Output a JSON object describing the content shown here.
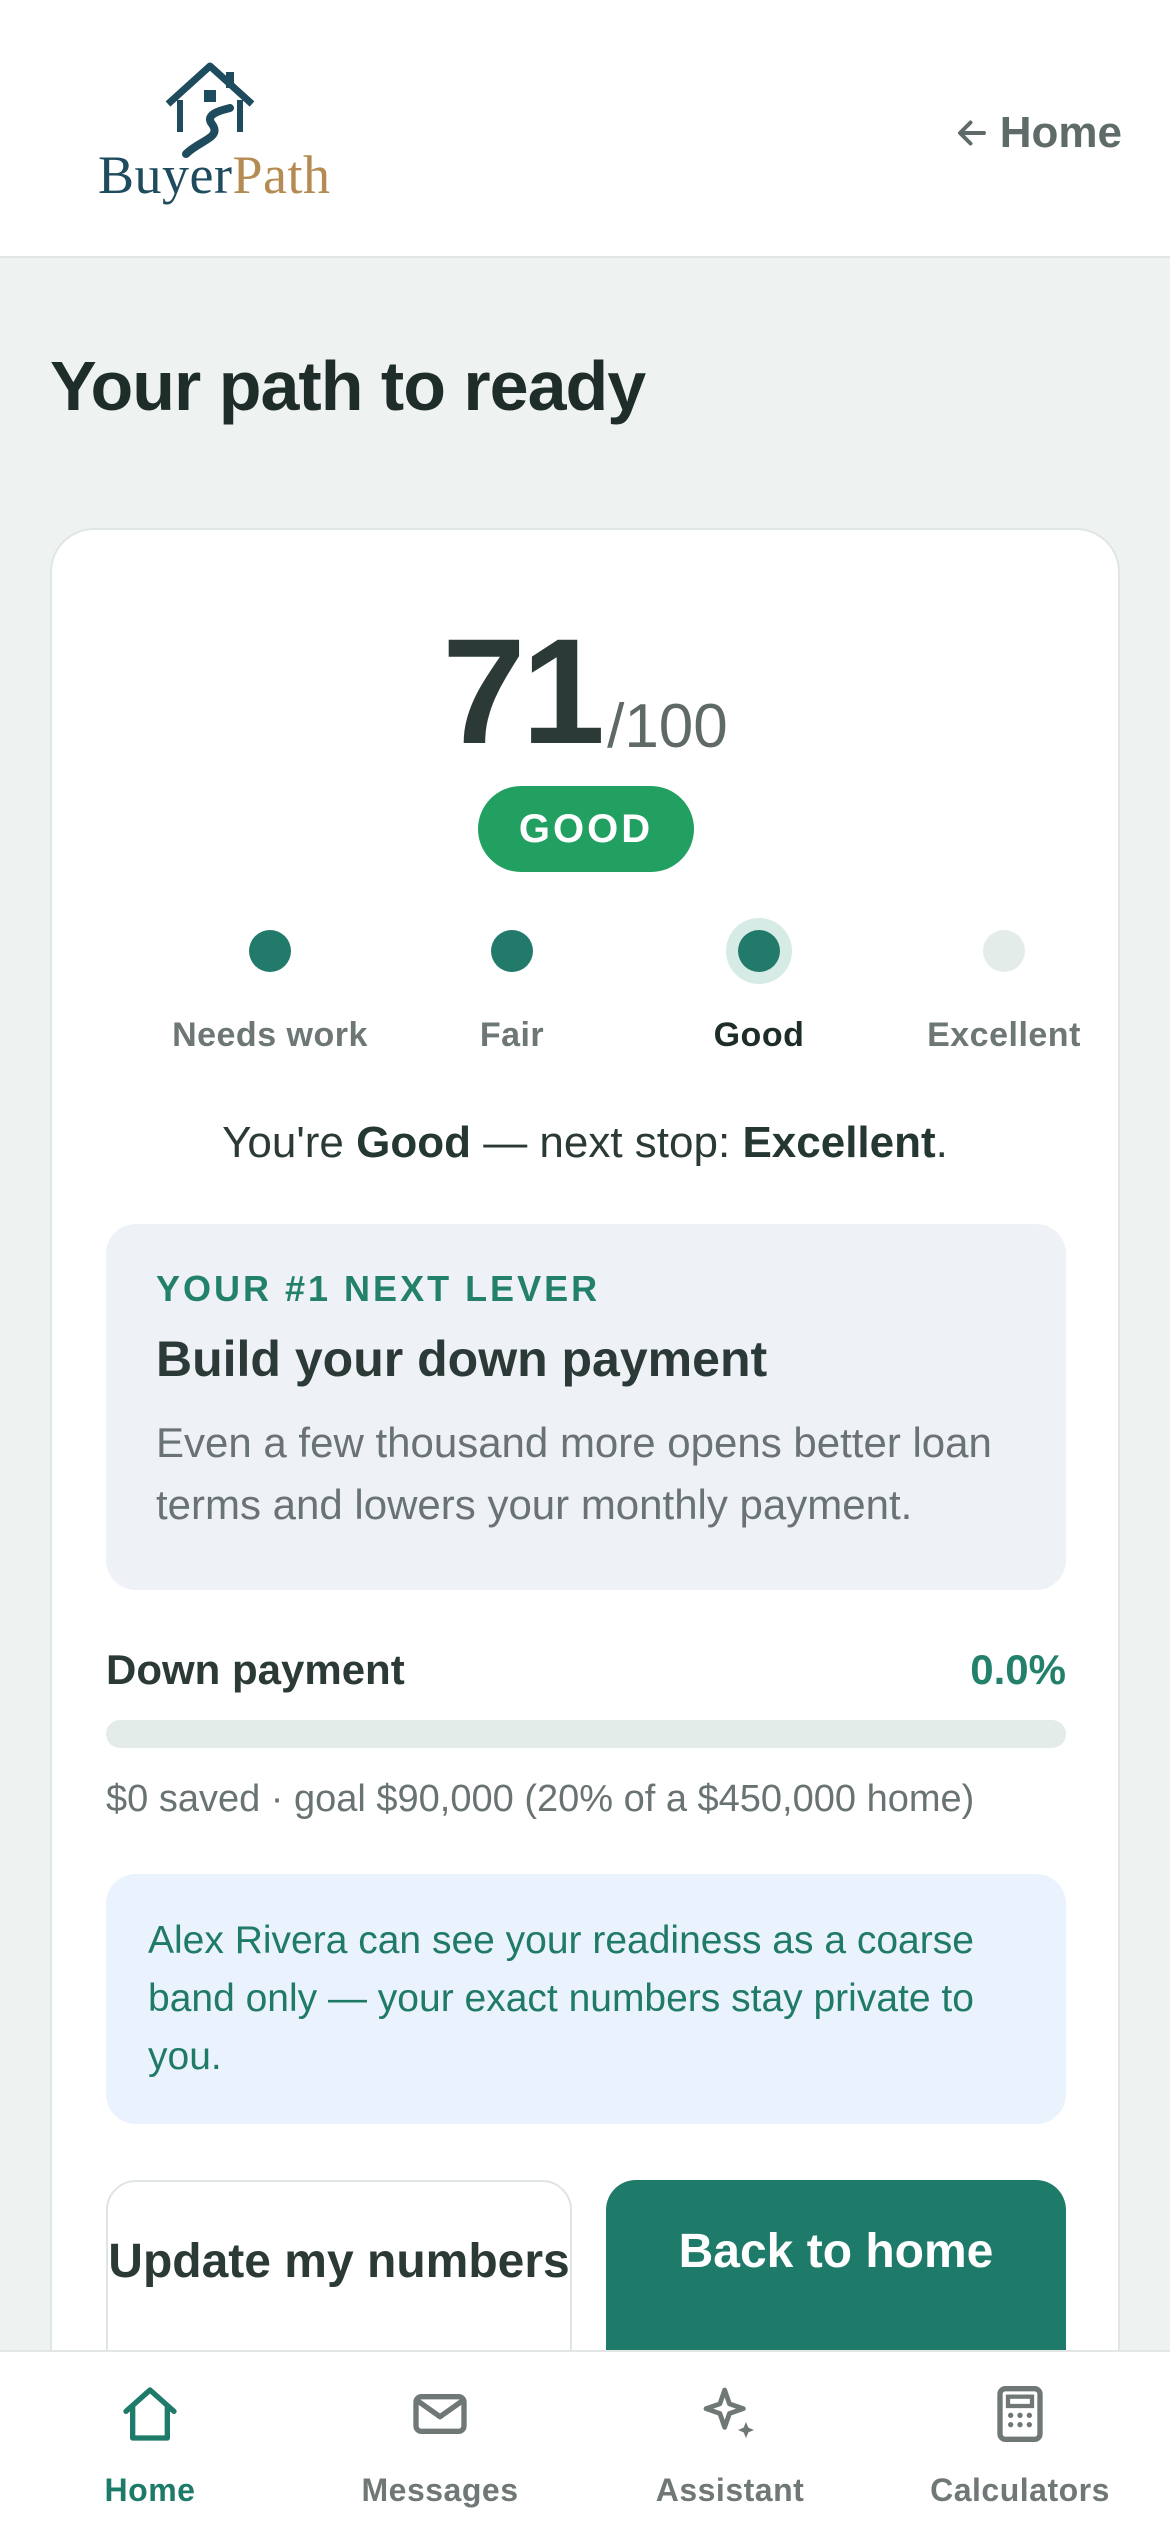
{
  "header": {
    "logo_text_1": "Buyer",
    "logo_text_2": "Path",
    "home_link": "Home"
  },
  "page_title": "Your path to ready",
  "score": {
    "value": "71",
    "out_of": "/100",
    "badge": "GOOD"
  },
  "steps": [
    {
      "label": "Needs work",
      "state": "done"
    },
    {
      "label": "Fair",
      "state": "done"
    },
    {
      "label": "Good",
      "state": "current"
    },
    {
      "label": "Excellent",
      "state": "future"
    }
  ],
  "status": {
    "prefix": "You're ",
    "current": "Good",
    "middle": " — next stop: ",
    "next": "Excellent",
    "suffix": "."
  },
  "lever": {
    "eyebrow": "YOUR #1 NEXT LEVER",
    "title": "Build your down payment",
    "body": "Even a few thousand more opens better loan terms and lowers your monthly payment."
  },
  "down_payment": {
    "label": "Down payment",
    "percent_text": "0.0%",
    "progress_fraction": 0.0,
    "caption": "$0 saved · goal $90,000 (20% of a $450,000 home)"
  },
  "privacy_note": "Alex Rivera can see your readiness as a coarse band only — your exact numbers stay private to you.",
  "buttons": {
    "update": "Update my numbers",
    "back": "Back to home"
  },
  "tabs": [
    {
      "label": "Home",
      "icon": "home-icon",
      "active": true
    },
    {
      "label": "Messages",
      "icon": "envelope-icon",
      "active": false
    },
    {
      "label": "Assistant",
      "icon": "sparkle-icon",
      "active": false
    },
    {
      "label": "Calculators",
      "icon": "calculator-icon",
      "active": false
    }
  ],
  "colors": {
    "brand_green": "#1e7a69",
    "badge_green": "#22a061",
    "logo_navy": "#1f4b5e",
    "logo_gold": "#b48b52"
  }
}
